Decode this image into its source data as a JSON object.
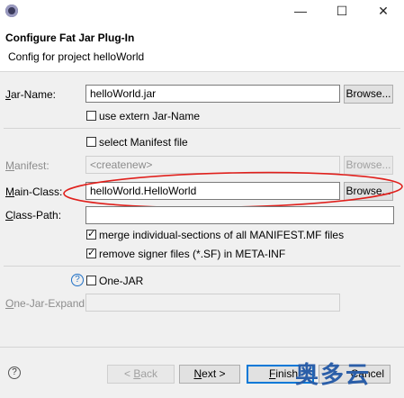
{
  "window": {
    "minimize_glyph": "—",
    "maximize_glyph": "☐",
    "close_glyph": "✕"
  },
  "header": {
    "title": "Configure Fat Jar Plug-In",
    "subtitle": "Config for project helloWorld"
  },
  "form": {
    "jar_name": {
      "label_u": "J",
      "label_rest": "ar-Name:",
      "value": "helloWorld.jar",
      "browse": "Browse..."
    },
    "use_extern": {
      "label": "use extern Jar-Name",
      "checked": false
    },
    "select_manifest": {
      "label": "select Manifest file",
      "checked": false
    },
    "manifest": {
      "label_u": "M",
      "label_rest": "anifest:",
      "value": "<createnew>",
      "browse": "Browse..."
    },
    "main_class": {
      "label_u": "M",
      "label_rest": "ain-Class:",
      "value": "helloWorld.HelloWorld",
      "browse": "Browse..."
    },
    "class_path": {
      "label_u": "C",
      "label_rest": "lass-Path:",
      "value": ""
    },
    "merge": {
      "label": "merge individual-sections of all MANIFEST.MF files",
      "checked": true
    },
    "remove_signer": {
      "label": "remove signer files (*.SF) in META-INF",
      "checked": true
    },
    "one_jar": {
      "label": "One-JAR",
      "checked": false
    },
    "one_jar_expand": {
      "label_u": "O",
      "label_rest": "ne-Jar-Expand:",
      "value": ""
    }
  },
  "footer": {
    "help_glyph": "?",
    "back_prefix": "< ",
    "back_u": "B",
    "back_rest": "ack",
    "next_u": "N",
    "next_rest": "ext >",
    "finish_u": "F",
    "finish_rest": "inish",
    "cancel": "Cancel"
  },
  "watermark": {
    "text": "奥多云"
  },
  "colors": {
    "highlight_ellipse": "#e0201c",
    "primary_button_border": "#0078d7",
    "watermark": "#2b5ea8"
  }
}
